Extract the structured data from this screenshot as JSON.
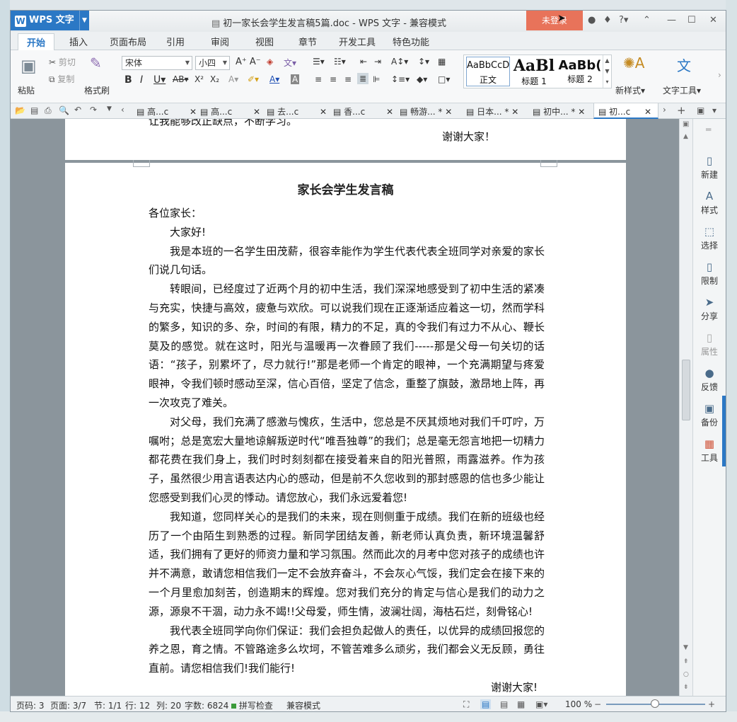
{
  "app": {
    "name": "WPS 文字",
    "doc_title": "初一家长会学生发言稿5篇.doc - WPS 文字 - 兼容模式",
    "login": "未登录"
  },
  "tabs": [
    "开始",
    "插入",
    "页面布局",
    "引用",
    "审阅",
    "视图",
    "章节",
    "开发工具",
    "特色功能"
  ],
  "ribbon": {
    "paste": "粘贴",
    "cut": "剪切",
    "copy": "复制",
    "format_painter": "格式刷",
    "font": "宋体",
    "size": "小四",
    "styles": [
      {
        "sample": "AaBbCcD",
        "name": "正文"
      },
      {
        "sample": "AaBl",
        "name": "标题 1"
      },
      {
        "sample": "AaBb(",
        "name": "标题 2"
      }
    ],
    "new_style": "新样式",
    "text_tools": "文字工具"
  },
  "doc_tabs": [
    "高...c",
    "高...c",
    "去...c",
    "香...c",
    "畅游... *",
    "日本... *",
    "初中... *",
    "初...c"
  ],
  "document": {
    "prev_tail": "让我能够改正缺点，不断学习。",
    "prev_thanks": "谢谢大家！",
    "heading": "家长会学生发言稿",
    "salutation": "各位家长：",
    "greeting": "大家好!",
    "p1": "我是本班的一名学生田茂薪，很容幸能作为学生代表代表全班同学对亲爱的家长们说几句话。",
    "p2": "转眼间，已经度过了近两个月的初中生活，我们深深地感受到了初中生活的紧凑与充实，快捷与高效，疲惫与欢欣。可以说我们现在正逐渐适应着这一切，然而学科的繁多，知识的多、杂，时间的有限，精力的不足，真的令我们有过力不从心、鞭长莫及的感觉。就在这时，阳光与温暖再一次眷顾了我们-----那是父母一句关切的话语：“孩子，别累坏了，尽力就行!”那是老师一个肯定的眼神，一个充满期望与疼爱眼神，令我们顿时感动至深，信心百倍，坚定了信念，重整了旗鼓，激昂地上阵，再一次攻克了难关。",
    "p3": "对父母，我们充满了感激与愧疚，生活中，您总是不厌其烦地对我们千叮咛，万嘱咐；总是宽宏大量地谅解叛逆时代“唯吾独尊”的我们；总是毫无怨言地把一切精力都花费在我们身上，我们时时刻刻都在接受着来自的阳光普照，雨露滋养。作为孩子，虽然很少用言语表达内心的感动，但是前不久您收到的那封感恩的信也多少能让您感受到我们心灵的悸动。请您放心，我们永远爱着您!",
    "p4": "我知道，您同样关心的是我们的未来，现在则侧重于成绩。我们在新的班级也经历了一个由陌生到熟悉的过程。新同学团结友善，新老师认真负责，新环境温馨舒适，我们拥有了更好的师资力量和学习氛围。然而此次的月考中您对孩子的成绩也许并不满意，敢请您相信我们一定不会放弃奋斗，不会灰心气馁，我们定会在接下来的一个月里愈加刻苦，创造期末的辉煌。您对我们充分的肯定与信心是我们的动力之源，源泉不干涸，动力永不竭!!父母爱，师生情，波澜壮阔，海枯石烂，刻骨铭心!",
    "p5": "我代表全班同学向你们保证：我们会担负起做人的责任，以优异的成绩回报您的养之恩，育之情。不管路途多么坎坷，不管苦难多么顽劣，我们都会义无反顾，勇往直前。请您相信我们!我们能行!",
    "tail": "谢谢大家!"
  },
  "sidebar": [
    "新建",
    "样式",
    "选择",
    "限制",
    "分享",
    "属性",
    "反馈",
    "备份",
    "工具"
  ],
  "status": {
    "page": "页码: 3",
    "pages": "页面: 3/7",
    "section": "节: 1/1",
    "row": "行: 12",
    "col": "列: 20",
    "words": "字数: 6824",
    "spell": "拼写检查",
    "compat": "兼容模式",
    "zoom": "100 %"
  }
}
